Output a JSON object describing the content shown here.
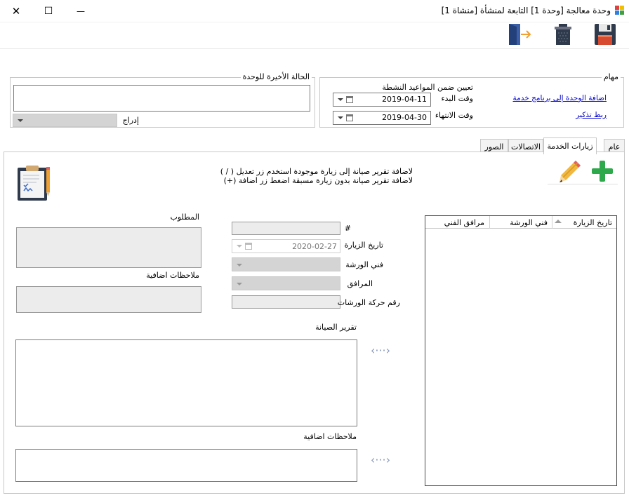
{
  "window": {
    "title": "وحدة معالجة [وحدة 1] التابعة لمنشأة [منشاة 1]",
    "minimize": "—",
    "maximize": "☐",
    "close": "✕"
  },
  "toolbar": {
    "save_icon": "save-icon",
    "delete_icon": "trash-icon",
    "exit_icon": "exit-door-icon"
  },
  "tasks": {
    "title": "مهام",
    "add_to_service_link": "اضافة الوحدة إلى برنامج خدمة",
    "link_reminder": "ربط تذكير",
    "active_schedule_title": "تعيين ضمن المواعيد النشطة",
    "start_label": "وقت البدء",
    "start_value": "2019-04-11",
    "end_label": "وقت الانتهاء",
    "end_value": "2019-04-30"
  },
  "last_status": {
    "title": "الحالة الأخيرة للوحدة",
    "text_value": "",
    "insert_label": "إدراج",
    "insert_select_value": ""
  },
  "tabs": [
    {
      "label": "عام"
    },
    {
      "label": "زيارات الخدمة"
    },
    {
      "label": "الاتصالات"
    },
    {
      "label": "الصور"
    }
  ],
  "visits": {
    "hint_edit": "لاضافة تقرير صيانة إلى زيارة موجودة استخدم زر تعديل ( / )",
    "hint_add": "لاضافة تقرير صيانة بدون زيارة مسبقة اضغط زر اضافة (+)",
    "grid_columns": [
      "تاريخ الزيارة",
      "فني الورشة",
      "مرافق الفني"
    ],
    "grid_rows": [],
    "number_label": "#",
    "number_value": "",
    "visit_date_label": "تاريخ الزيارة",
    "visit_date_value": "2020-02-27",
    "workshop_tech_label": "فني الورشة",
    "companion_label": "المرافق",
    "workshop_move_label": "رقم حركة الورشات",
    "workshop_move_value": "",
    "required_label": "المطلوب",
    "required_value": "",
    "extra_notes_label": "ملاحظات اضافية",
    "extra_notes_value": "",
    "report_label": "تقرير الصيانة",
    "report_value": "",
    "extra_notes2_label": "ملاحظات اضافية",
    "extra_notes2_value": "",
    "more_glyph": "‹···›"
  }
}
